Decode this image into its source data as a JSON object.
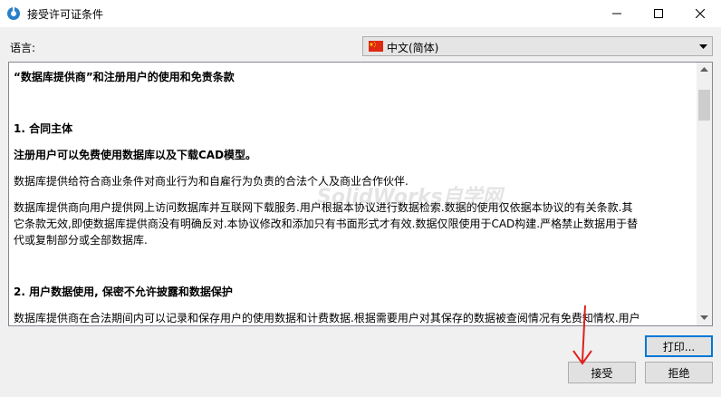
{
  "window": {
    "title": "接受许可证条件",
    "minimize_icon": "minimize-icon",
    "maximize_icon": "maximize-icon",
    "close_icon": "close-icon"
  },
  "language": {
    "label": "语言:",
    "selected": "中文(简体)",
    "flag": "china-flag-icon"
  },
  "document": {
    "heading": "“数据库提供商”和注册用户的使用和免责条款",
    "section1_title": "1. 合同主体",
    "section1_bold": "注册用户可以免费使用数据库以及下载CAD模型。",
    "section1_p1": "数据库提供给符合商业条件对商业行为和自雇行为负责的合法个人及商业合作伙伴.",
    "section1_p2_line1": "数据库提供商向用户提供网上访问数据库并互联网下载服务.用户根据本协议进行数据检索.数据的使用仅依据本协议的有关条款.其",
    "section1_p2_line2": "它条款无效,即使数据库提供商没有明确反对.本协议修改和添加只有书面形式才有效.数据仅限使用于CAD构建.严格禁止数据用于替",
    "section1_p2_line3": "代或复制部分或全部数据库.",
    "section2_title": "2. 用户数据使用, 保密不允许披露和数据保护",
    "section2_p1_line1": "数据库提供商在合法期间内可以记录和保存用户的使用数据和计费数据.根据需要用户对其保存的数据被查阅情况有免费知情权.用户"
  },
  "watermark": "SolidWorks自学网",
  "buttons": {
    "print": "打印...",
    "accept": "接受",
    "reject": "拒绝"
  },
  "colors": {
    "focus_border": "#0078d7",
    "annotation": "#e02020"
  }
}
